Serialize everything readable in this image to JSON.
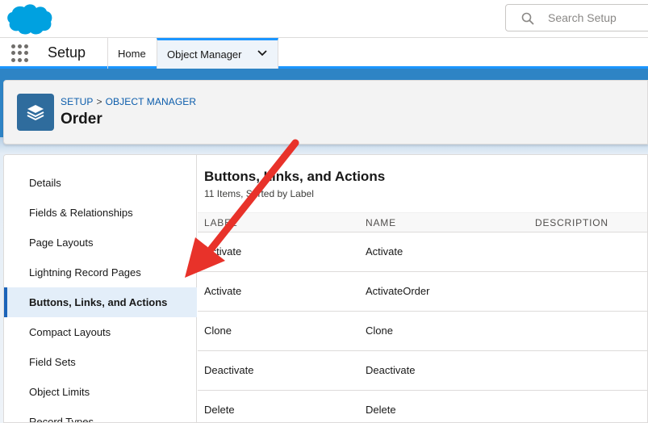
{
  "header": {
    "search_placeholder": "Search Setup"
  },
  "context_bar": {
    "app_name": "Setup",
    "tabs": [
      {
        "label": "Home"
      },
      {
        "label": "Object Manager"
      }
    ]
  },
  "object_header": {
    "breadcrumb": [
      "SETUP",
      "OBJECT MANAGER"
    ],
    "breadcrumb_separator": ">",
    "title": "Order"
  },
  "left_nav": {
    "items": [
      {
        "label": "Details"
      },
      {
        "label": "Fields & Relationships"
      },
      {
        "label": "Page Layouts"
      },
      {
        "label": "Lightning Record Pages"
      },
      {
        "label": "Buttons, Links, and Actions"
      },
      {
        "label": "Compact Layouts"
      },
      {
        "label": "Field Sets"
      },
      {
        "label": "Object Limits"
      },
      {
        "label": "Record Types"
      }
    ],
    "active_index": 4
  },
  "content": {
    "title": "Buttons, Links, and Actions",
    "subtitle": "11 Items, Sorted by Label",
    "columns": [
      "LABEL",
      "NAME",
      "DESCRIPTION"
    ],
    "rows": [
      {
        "label": "Activate",
        "name": "Activate",
        "description": ""
      },
      {
        "label": "Activate",
        "name": "ActivateOrder",
        "description": ""
      },
      {
        "label": "Clone",
        "name": "Clone",
        "description": ""
      },
      {
        "label": "Deactivate",
        "name": "Deactivate",
        "description": ""
      },
      {
        "label": "Delete",
        "name": "Delete",
        "description": ""
      }
    ]
  },
  "colors": {
    "brand_blue": "#00a1e0",
    "active_nav_border": "#1b63b8",
    "annotation_arrow": "#e8322a",
    "link_blue": "#0b5cab",
    "object_icon_bg": "#2f6c9d"
  },
  "icons": {
    "logo": "salesforce-cloud-logo",
    "search": "search-icon",
    "launcher": "app-launcher-icon",
    "tab_menu": "chevron-down-icon",
    "object": "layers-icon",
    "annotation": "arrow-icon"
  }
}
